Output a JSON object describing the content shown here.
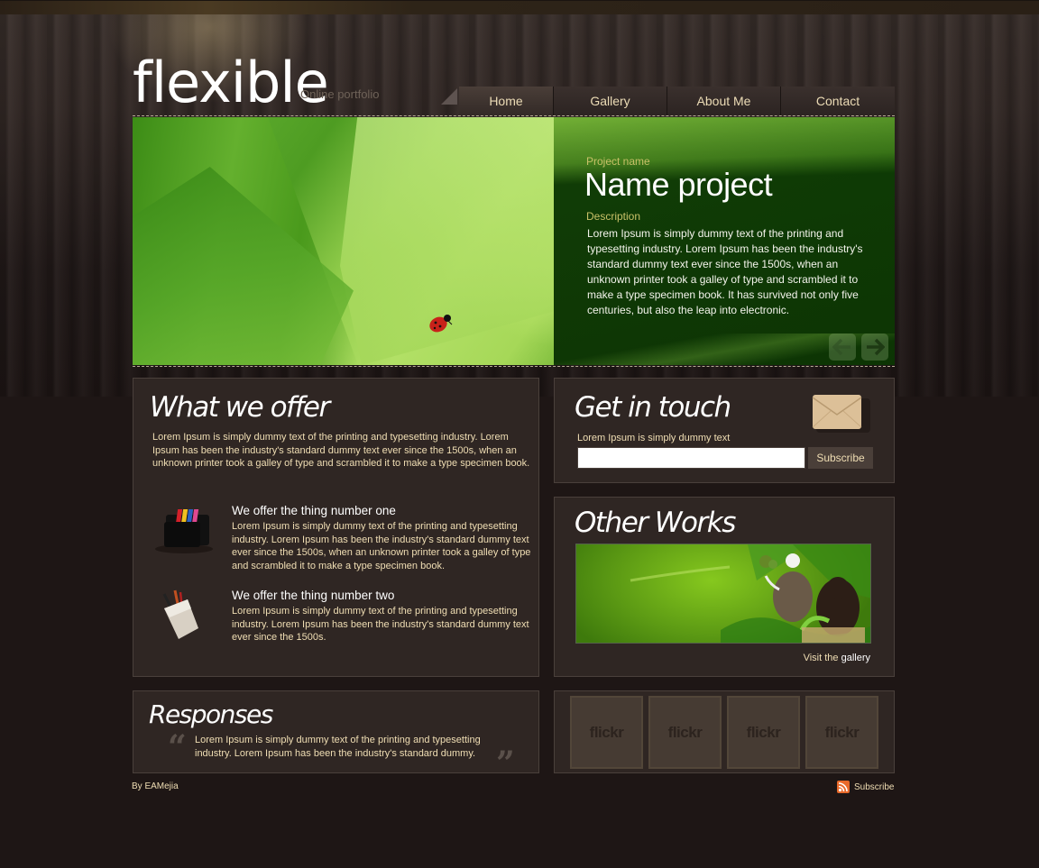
{
  "header": {
    "logo": "flexible",
    "tagline": "Online portfolio"
  },
  "nav": {
    "items": [
      {
        "label": "Home",
        "active": true
      },
      {
        "label": "Gallery",
        "active": false
      },
      {
        "label": "About Me",
        "active": false
      },
      {
        "label": "Contact",
        "active": false
      }
    ]
  },
  "slider": {
    "project_label": "Project name",
    "project_title": "Name project",
    "description_label": "Description",
    "description": "Lorem Ipsum is simply dummy text of the printing and typesetting industry. Lorem Ipsum has been the industry's standard dummy text ever since the 1500s, when an unknown printer took a galley of type and scrambled it to make a type specimen book. It has survived not only five centuries, but also the leap into electronic.",
    "prev_icon": "arrow-left-icon",
    "next_icon": "arrow-right-icon"
  },
  "offer": {
    "title": "What we offer",
    "intro": "Lorem Ipsum is simply dummy text of the printing and typesetting industry. Lorem Ipsum has been the industry's standard dummy text ever since the 1500s, when an unknown printer took a galley of type and scrambled it to make a type specimen book.",
    "features": [
      {
        "title": "We offer the thing number one",
        "text": "Lorem Ipsum is simply dummy text of the printing and typesetting industry. Lorem Ipsum has been the industry's standard dummy text ever since the 1500s, when an unknown printer took a galley of type and scrambled it to make a type specimen book.",
        "icon": "folders-icon"
      },
      {
        "title": "We offer the thing number two",
        "text": "Lorem Ipsum is simply dummy text of the printing and typesetting industry. Lorem Ipsum has been the industry's standard dummy text ever since the 1500s.",
        "icon": "pencil-pocket-icon"
      }
    ]
  },
  "touch": {
    "title": "Get in touch",
    "label": "Lorem Ipsum is simply dummy text",
    "input_value": "",
    "button": "Subscribe",
    "icon": "envelope-icon"
  },
  "works": {
    "title": "Other Works",
    "visit_prefix": "Visit the",
    "visit_link": "gallery"
  },
  "responses": {
    "title": "Responses",
    "open_quote": "“",
    "close_quote": "”",
    "quote": "Lorem Ipsum is simply dummy text of the printing and typesetting industry. Lorem Ipsum has been the industry's standard dummy."
  },
  "flickr": {
    "thumbs": [
      "flickr",
      "flickr",
      "flickr",
      "flickr"
    ]
  },
  "footer": {
    "credit": "By EAMejia",
    "subscribe": "Subscribe",
    "subscribe_icon": "rss-icon"
  },
  "colors": {
    "background": "#1e1615",
    "box": "#2f2623",
    "cream_text": "#f0deb4",
    "caption_label": "#c8c068",
    "rss": "#e8692a"
  }
}
